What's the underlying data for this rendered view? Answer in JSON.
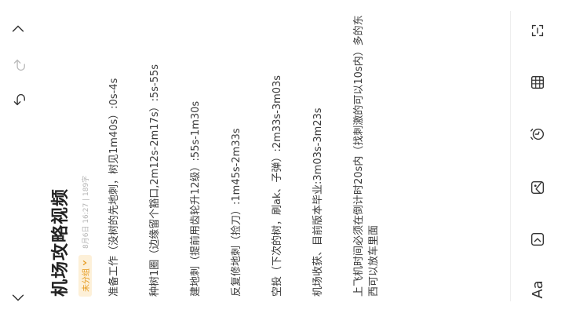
{
  "note": {
    "title": "机场攻略视频",
    "tag": "未分组",
    "meta": "8月6日 16:27 | 189字",
    "lines": [
      "准备工作（没树的先地刺，树见1m40s）:0s-4s",
      "种树1圈（边缘留个豁口,2m12s-2m17s）:5s-55s",
      "建地刺（提前用齿轮升12级）:55s-1m30s",
      "反复修地刺（捡刀）:1m45s-2m33s",
      "空投（下次的树，刷ak、子弹）:2m33s-3m03s",
      "机场收获、目前版本毕业:3m03s-3m23s",
      "上飞机时间必须在倒计时20s内（找刺激的可以10s内）多的东西可以放车里面"
    ]
  },
  "nav": {
    "icons": [
      "back-icon",
      "undo-icon",
      "redo-icon",
      "forward-icon"
    ]
  },
  "toolbar": {
    "text_format_label": "Aa",
    "icons": [
      "text-format",
      "checkbox-icon",
      "image-icon",
      "alarm-clock-icon",
      "table-icon",
      "scan-icon"
    ]
  },
  "colors": {
    "accent": "#e69a1e",
    "tag_bg": "#fdf0d8",
    "text": "#333333"
  }
}
